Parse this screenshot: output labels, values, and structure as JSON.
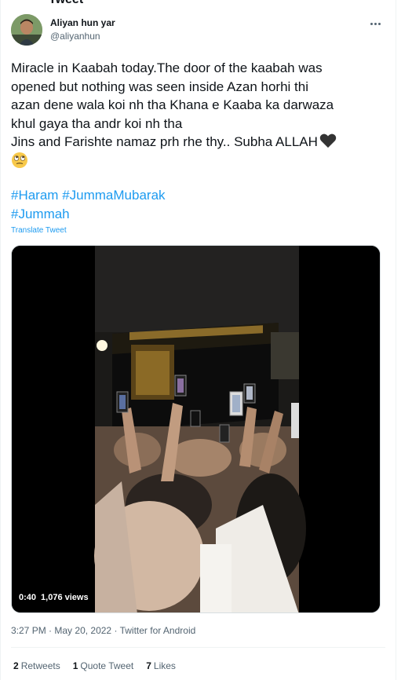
{
  "header_clip": "Tweet",
  "author": {
    "name": "Aliyan hun yar",
    "handle": "@aliyanhun"
  },
  "tweet": {
    "lines": [
      "Miracle in Kaabah today.The door of the kaabah was",
      "opened but nothing was seen inside Azan horhi thi",
      "azan dene wala koi nh tha Khana e Kaaba ka darwaza",
      "khul gaya tha andr koi nh tha",
      "Jins and Farishte namaz prh rhe thy.. Subha ALLAH"
    ],
    "hashtags": [
      "#Haram",
      "#JummaMubarak",
      "#Jummah"
    ],
    "translate_label": "Translate Tweet",
    "emoji": [
      "black-heart-icon",
      "rolling-eyes-face-icon"
    ]
  },
  "video": {
    "duration": "0:40",
    "views": "1,076 views"
  },
  "meta": {
    "time": "3:27 PM",
    "date": "May 20, 2022",
    "source": "Twitter for Android",
    "separator": "·"
  },
  "stats": {
    "retweets_count": "2",
    "retweets_label": "Retweets",
    "quotes_count": "1",
    "quotes_label": "Quote Tweet",
    "likes_count": "7",
    "likes_label": "Likes"
  },
  "colors": {
    "link": "#1d9bf0",
    "secondary_text": "#536471",
    "primary_text": "#0f1419"
  }
}
